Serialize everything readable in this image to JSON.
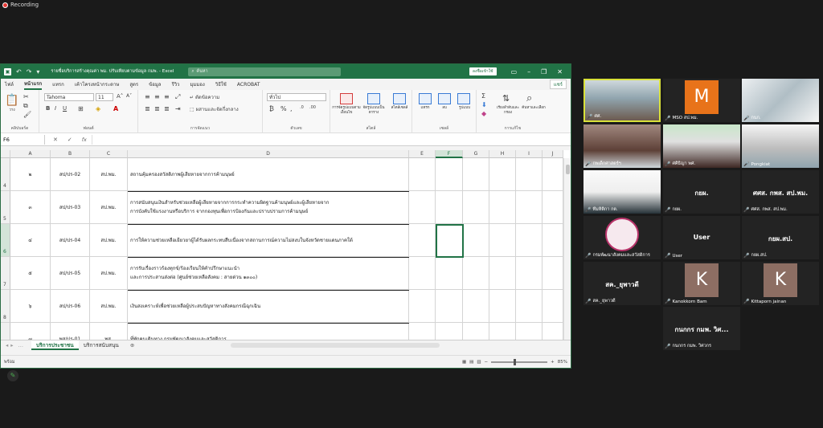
{
  "recording": {
    "label": "Recording"
  },
  "excel": {
    "title": "รายชื่อบริการสร้างคุณค่า พม. ปรับเทียบตามข้อมูล กมพ. - Excel",
    "search_placeholder": "ค้นหา",
    "signin_label": "ลงชื่อเข้าใช้",
    "share_label": "แชร์",
    "tabs": [
      "ไฟล์",
      "หน้าแรก",
      "แทรก",
      "เค้าโครงหน้ากระดาษ",
      "สูตร",
      "ข้อมูล",
      "รีวิว",
      "มุมมอง",
      "วิธีใช้",
      "ACROBAT"
    ],
    "ribbon": {
      "font_name": "Tahoma",
      "font_size": "11",
      "number_format": "ทั่วไป",
      "wrap_text": "ตัดข้อความ",
      "merge_center": "ผสานและจัดกึ่งกลาง",
      "cond_format": "การจัดรูปแบบตามเงื่อนไข",
      "format_table": "จัดรูปแบบเป็นตาราง",
      "cell_styles": "สไตล์เซลล์",
      "insert": "แทรก",
      "delete": "ลบ",
      "format": "รูปแบบ",
      "sort_filter": "เรียงลำดับและกรอง",
      "find_select": "ค้นหาและเลือก",
      "groups": [
        "คลิปบอร์ด",
        "ฟอนต์",
        "การจัดแนว",
        "ตัวเลข",
        "สไตล์",
        "เซลล์",
        "การแก้ไข"
      ],
      "paste": "วาง"
    },
    "name_box": "F6",
    "columns": [
      "A",
      "B",
      "C",
      "D",
      "E",
      "F",
      "G",
      "H",
      "I",
      "J"
    ],
    "rows": [
      {
        "num": "4",
        "a": "๒",
        "b": "สป/ปร-02",
        "c": "สป.พม.",
        "d": [
          "สถานคุ้มครองสวัสดิภาพผู้เสียหายจากการค้ามนุษย์"
        ]
      },
      {
        "num": "5",
        "a": "๓",
        "b": "สป/ปร-03",
        "c": "สป.พม.",
        "d": [
          "การสนับสนุนเงินสำหรับช่วยเหลือผู้เสียหายจากการกระทำความผิดฐานค้ามนุษย์และผู้เสียหายจาก",
          "การบังคับใช้แรงงานหรือบริการ จากกองทุนเพื่อการป้องกันและปราบปรามการค้ามนุษย์"
        ]
      },
      {
        "num": "6",
        "a": "๔",
        "b": "สป/ปร-04",
        "c": "สป.พม.",
        "d": [
          "การให้ความช่วยเหลือเยียวยาผู้ได้รับผลกระทบสืบเนื่องจากสถานการณ์ความไม่สงบในจังหวัดชายแดนภาคใต้"
        ]
      },
      {
        "num": "7",
        "a": "๕",
        "b": "สป/ปร-05",
        "c": "สป.พม.",
        "d": [
          "การรับเรื่องราวร้องทุกข์/ร้องเรียนให้คำปรึกษาแนะนำ",
          "และการประสานส่งต่อ (ศูนย์ช่วยเหลือสังคม : สายด่วน ๑๓๐๐)"
        ]
      },
      {
        "num": "8",
        "a": "๖",
        "b": "สป/ปร-06",
        "c": "สป.พม.",
        "d": [
          "เงินสงเคราะห์เพื่อช่วยเหลือผู้ประสบปัญหาทางสังคมกรณีฉุกเฉิน"
        ]
      },
      {
        "num": "9",
        "a": "๗",
        "b": "พส/ปร-01",
        "c": "พส.",
        "d": [
          "ที่พักคนเดินทาง กรมพัฒนาสังคมและสวัสดิการ"
        ]
      }
    ],
    "sheets": [
      "บริการประชาชน",
      "บริการสนับสนุน"
    ],
    "status": {
      "ready": "พร้อม",
      "zoom": "85%"
    }
  },
  "participants": [
    {
      "name": "ศศ.",
      "type": "video",
      "active": true
    },
    {
      "name": "MSO สป.พม.",
      "type": "avatar",
      "initial": "M",
      "color": "#e8731a"
    },
    {
      "name": "กบภ.",
      "type": "video"
    },
    {
      "name": "กพเด็กศาสตร์ฯ",
      "type": "video"
    },
    {
      "name": "ศศิธิญา พศ.",
      "type": "video"
    },
    {
      "name": "Pongkiat",
      "type": "video"
    },
    {
      "name": "ทีมหิติกา กต.",
      "type": "video"
    },
    {
      "name": "กยผ.",
      "type": "text",
      "title": "กยผ."
    },
    {
      "name": "ศศส. กพส. สป.พม.",
      "type": "text",
      "title": "ศศส. กพส. สป.พม."
    },
    {
      "name": "กรมพัฒนาสังคมและสวัสดิการ",
      "type": "seal"
    },
    {
      "name": "User",
      "type": "text",
      "title": "User"
    },
    {
      "name": "กยผ.สป.",
      "type": "text",
      "title": "กยผ.สป."
    },
    {
      "name": "สค._ยุพาวดี",
      "type": "text",
      "title": "สค._ยุพาวดี"
    },
    {
      "name": "Kanokkorn Bam",
      "type": "avatar",
      "initial": "K",
      "color": "#8d6e63"
    },
    {
      "name": "Kittaporn jainan",
      "type": "avatar",
      "initial": "K",
      "color": "#8d6e63"
    },
    {
      "name": "กนกกร กมพ. วิศวกร",
      "type": "text",
      "title": "กนกกร กมพ. วิศ..."
    }
  ]
}
